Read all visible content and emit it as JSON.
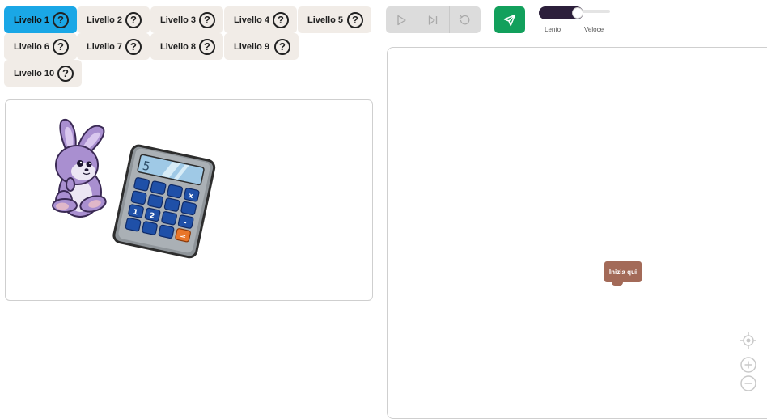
{
  "levels": [
    {
      "label": "Livello 1",
      "active": true
    },
    {
      "label": "Livello 2",
      "active": false
    },
    {
      "label": "Livello 3",
      "active": false
    },
    {
      "label": "Livello 4",
      "active": false
    },
    {
      "label": "Livello 5",
      "active": false
    },
    {
      "label": "Livello 6",
      "active": false
    },
    {
      "label": "Livello 7",
      "active": false
    },
    {
      "label": "Livello 8",
      "active": false
    },
    {
      "label": "Livello 9",
      "active": false
    },
    {
      "label": "Livello 10",
      "active": false
    }
  ],
  "help_glyph": "?",
  "toolbar": {
    "run_icon": "play-icon",
    "step_icon": "step-forward-icon",
    "reset_icon": "reset-icon",
    "send_icon": "send-icon"
  },
  "speed": {
    "slow_label": "Lento",
    "fast_label": "Veloce",
    "value": 0.55
  },
  "scene": {
    "characters": [
      "bunny",
      "calculator"
    ],
    "calculator_display": "5",
    "calculator_keys": [
      "x",
      "1",
      "2",
      "-",
      "="
    ]
  },
  "workspace": {
    "start_block_label": "Inizia qui",
    "controls": [
      "center-icon",
      "zoom-in-icon",
      "zoom-out-icon"
    ]
  },
  "colors": {
    "active_tab": "#1aa7e6",
    "tab": "#f1ece7",
    "send": "#12a05c",
    "start_block": "#a36a58",
    "slider": "#2c1f3b"
  }
}
